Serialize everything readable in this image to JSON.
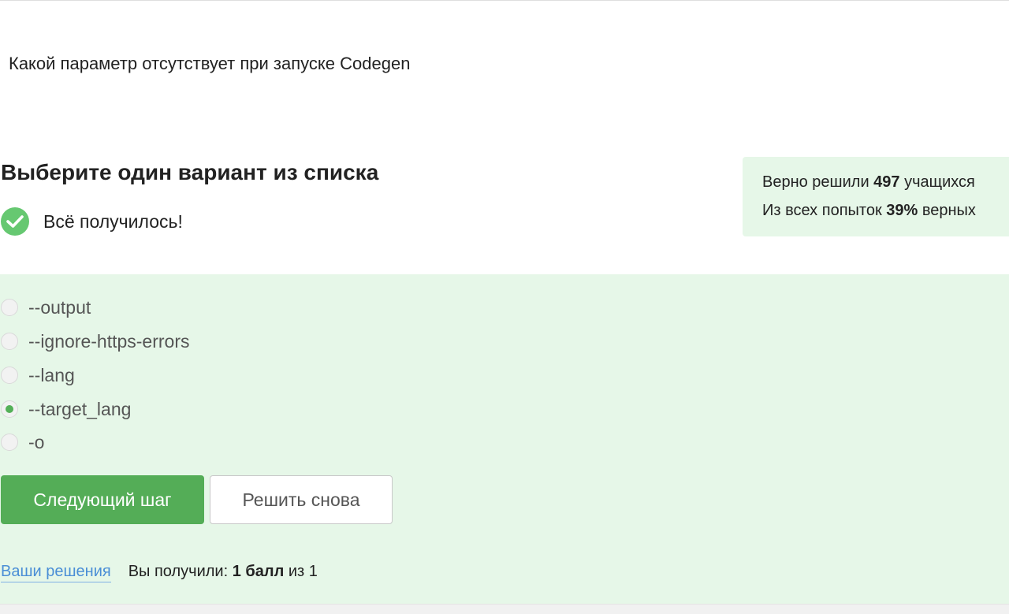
{
  "question": {
    "text": "Какой параметр отсутствует при запуске Codegen"
  },
  "task": {
    "heading": "Выберите один вариант из списка",
    "status_text": "Всё получилось!"
  },
  "stats": {
    "line1_prefix": "Верно решили ",
    "solved_count": "497",
    "line1_suffix": " учащихся",
    "line2_prefix": "Из всех попыток ",
    "success_rate": "39%",
    "line2_suffix": " верных"
  },
  "options": [
    {
      "label": "--output",
      "selected": false
    },
    {
      "label": "--ignore-https-errors",
      "selected": false
    },
    {
      "label": "--lang",
      "selected": false
    },
    {
      "label": "--target_lang",
      "selected": true
    },
    {
      "label": "-o",
      "selected": false
    }
  ],
  "buttons": {
    "next_label": "Следующий шаг",
    "retry_label": "Решить снова"
  },
  "footer": {
    "solutions_link": "Ваши решения",
    "score_prefix": "Вы получили: ",
    "score_value": "1 балл",
    "score_suffix": " из 1"
  },
  "colors": {
    "success_green": "#66c871",
    "button_green": "#54ad57",
    "area_background": "#e6f7e8",
    "link_blue": "#4a8ed6"
  },
  "icons": {
    "status": "check-circle-icon"
  }
}
